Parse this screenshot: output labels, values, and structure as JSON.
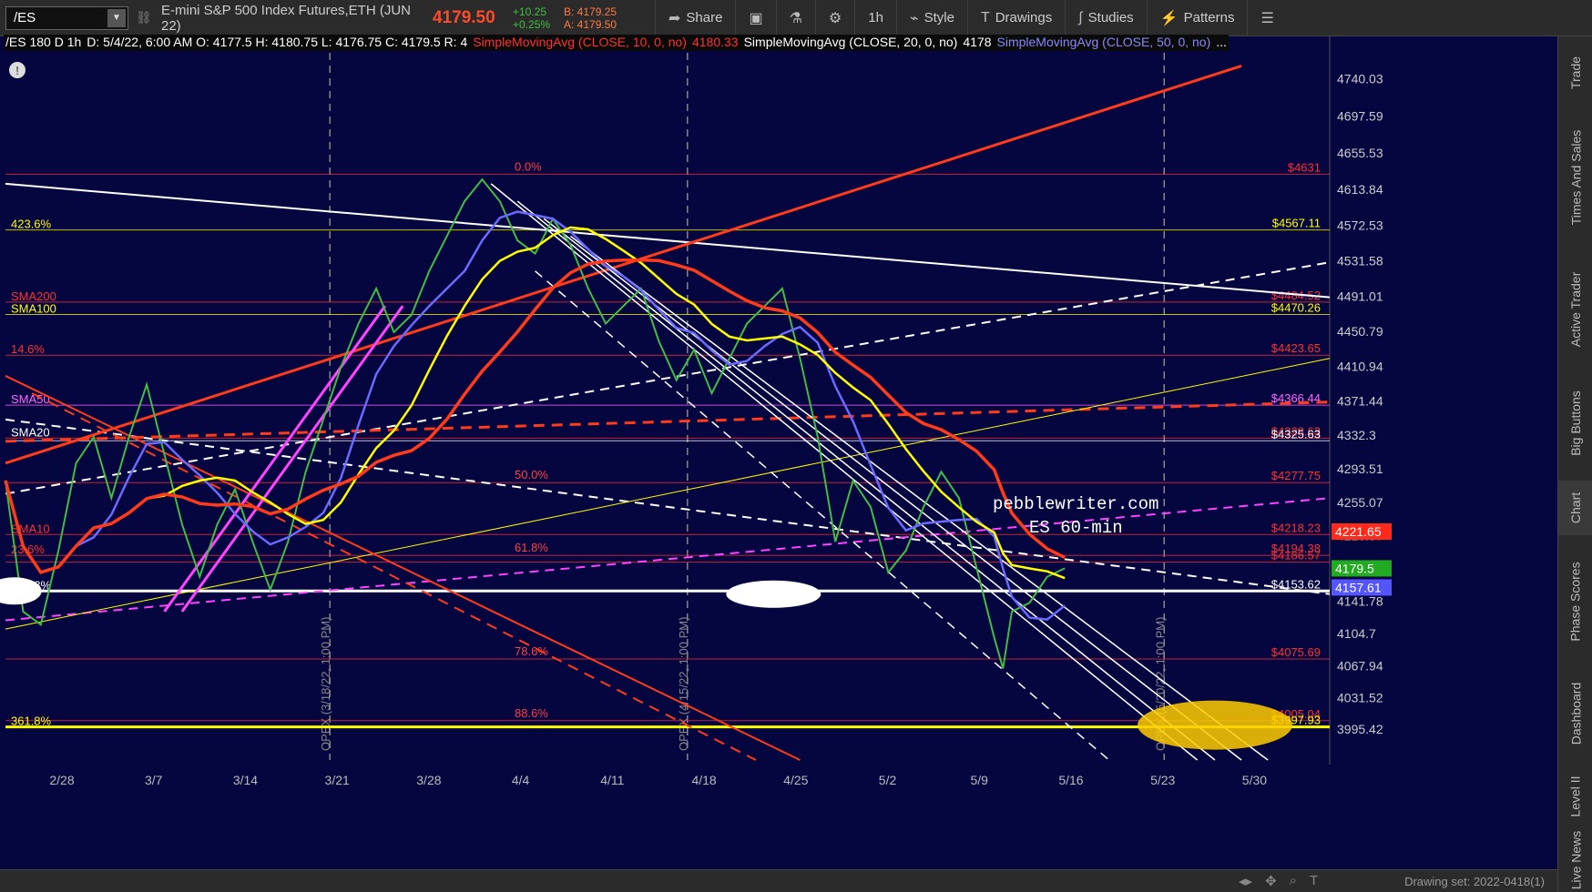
{
  "toolbar": {
    "symbol": "/ES",
    "instrument": "E-mini S&P 500 Index Futures,ETH (JUN 22)",
    "last": "4179.50",
    "change": "+10.25",
    "change_pct": "+0.25%",
    "bid": "B: 4179.25",
    "ask": "A: 4179.50",
    "buttons": [
      {
        "label": "Share",
        "icon": "share-icon"
      },
      {
        "label": "",
        "icon": "screenshot-icon"
      },
      {
        "label": "",
        "icon": "flask-icon"
      },
      {
        "label": "",
        "icon": "gear-icon"
      },
      {
        "label": "1h",
        "icon": ""
      },
      {
        "label": "Style",
        "icon": "style-icon"
      },
      {
        "label": "Drawings",
        "icon": "drawings-icon"
      },
      {
        "label": "Studies",
        "icon": "studies-icon"
      },
      {
        "label": "Patterns",
        "icon": "patterns-icon"
      },
      {
        "label": "",
        "icon": "menu-icon"
      }
    ]
  },
  "header": {
    "study_line": "/ES 180 D 1h",
    "ohlc": "D: 5/4/22, 6:00 AM  O: 4177.5  H: 4180.75  L: 4176.75  C: 4179.5  R: 4",
    "sma10": "SimpleMovingAvg (CLOSE, 10, 0, no)",
    "sma10_val": "4180.33",
    "sma20": "SimpleMovingAvg (CLOSE, 20, 0, no)",
    "sma20_val": "4178",
    "sma50": "SimpleMovingAvg (CLOSE, 50, 0, no)",
    "more": "..."
  },
  "right_tabs": [
    "Trade",
    "Times And Sales",
    "Active Trader",
    "Big Buttons",
    "Chart",
    "Phase Scores",
    "Dashboard",
    "Level II",
    "Live News"
  ],
  "bottom": {
    "drawing_set": "Drawing set: 2022-0418(1)"
  },
  "chart_data": {
    "type": "line",
    "title": "pebblewriter.com",
    "subtitle": "ES 60-min",
    "xlabel": "",
    "ylabel": "",
    "ylim": [
      3960,
      4770
    ],
    "x_ticks": [
      "2/28",
      "3/7",
      "3/14",
      "3/21",
      "3/28",
      "4/4",
      "4/11",
      "4/18",
      "4/25",
      "5/2",
      "5/9",
      "5/16",
      "5/23",
      "5/30"
    ],
    "y_ticks": [
      "4740.03",
      "4697.59",
      "4655.53",
      "4613.84",
      "4572.53",
      "4531.58",
      "4491.01",
      "4450.79",
      "4410.94",
      "4371.44",
      "4332.3",
      "4293.51",
      "4255.07",
      "4216.97",
      "4141.78",
      "4104.7",
      "4067.94",
      "4031.52",
      "3995.42"
    ],
    "price_tags": [
      {
        "label": "4221.65",
        "value": 4221.65,
        "color": "#ff2a1a"
      },
      {
        "label": "4179.5",
        "value": 4179.5,
        "color": "#22aa22"
      },
      {
        "label": "4157.61",
        "value": 4157.61,
        "color": "#5555ff"
      }
    ],
    "level_labels": [
      {
        "label": "$4631",
        "value": 4631,
        "color": "#ff3030"
      },
      {
        "label": "$4567.11",
        "value": 4567.11,
        "color": "#ffff00"
      },
      {
        "label": "$4484.52",
        "value": 4484.52,
        "color": "#ff3030"
      },
      {
        "label": "$4470.26",
        "value": 4470.26,
        "color": "#ffff00"
      },
      {
        "label": "$4423.65",
        "value": 4423.65,
        "color": "#ff3030"
      },
      {
        "label": "$4366.44",
        "value": 4366.44,
        "color": "#ff66ff"
      },
      {
        "label": "$4328.63",
        "value": 4328.63,
        "color": "#ff3030"
      },
      {
        "label": "$4325.63",
        "value": 4325.63,
        "color": "#ffffff"
      },
      {
        "label": "$4277.75",
        "value": 4277.75,
        "color": "#ff3030"
      },
      {
        "label": "$4218.23",
        "value": 4218.23,
        "color": "#ff3030"
      },
      {
        "label": "$4194.38",
        "value": 4194.38,
        "color": "#ff3030"
      },
      {
        "label": "$4186.57",
        "value": 4186.57,
        "color": "#ff3030"
      },
      {
        "label": "$4153.62",
        "value": 4153.62,
        "color": "#ffffff"
      },
      {
        "label": "$4075.69",
        "value": 4075.69,
        "color": "#ff3030"
      },
      {
        "label": "$4005.04",
        "value": 4005.04,
        "color": "#ff3030"
      },
      {
        "label": "$3997.93",
        "value": 3997.93,
        "color": "#ffff00"
      }
    ],
    "fib_labels": [
      {
        "label": "0.0%",
        "value": 4631
      },
      {
        "label": "50.0%",
        "value": 4277.75
      },
      {
        "label": "61.8%",
        "value": 4194.38
      },
      {
        "label": "78.6%",
        "value": 4075.69
      },
      {
        "label": "88.6%",
        "value": 4005.04
      }
    ],
    "left_labels": [
      {
        "label": "423.6%",
        "value": 4567.11,
        "color": "#ffff00"
      },
      {
        "label": "SMA200",
        "value": 4484.52,
        "color": "#ff3030"
      },
      {
        "label": "SMA100",
        "value": 4470.26,
        "color": "#ffff00"
      },
      {
        "label": "14.6%",
        "value": 4423.65,
        "color": "#ff3030"
      },
      {
        "label": "SMA50",
        "value": 4366.44,
        "color": "#ff66ff"
      },
      {
        "label": "SMA20",
        "value": 4328.63,
        "color": "#ffffff"
      },
      {
        "label": "SMA10",
        "value": 4218.23,
        "color": "#ff3030"
      },
      {
        "label": "23.6%",
        "value": 4194.38,
        "color": "#ff3030"
      },
      {
        "label": "161.8%",
        "value": 4153.62,
        "color": "#ffffff"
      },
      {
        "label": "361.8%",
        "value": 3997.93,
        "color": "#ffff00"
      }
    ],
    "opex_labels": [
      "OPEX (3/18/22, 1:00 PM)",
      "OPEX (4/15/22, 1:00 PM)",
      "OPEX (5/20/22, 1:00 PM)"
    ],
    "price_path": [
      [
        0,
        4280
      ],
      [
        2,
        4130
      ],
      [
        4,
        4115
      ],
      [
        6,
        4200
      ],
      [
        8,
        4300
      ],
      [
        10,
        4330
      ],
      [
        12,
        4260
      ],
      [
        14,
        4330
      ],
      [
        16,
        4390
      ],
      [
        18,
        4310
      ],
      [
        20,
        4230
      ],
      [
        22,
        4170
      ],
      [
        24,
        4230
      ],
      [
        26,
        4270
      ],
      [
        28,
        4210
      ],
      [
        30,
        4155
      ],
      [
        32,
        4210
      ],
      [
        34,
        4290
      ],
      [
        36,
        4350
      ],
      [
        38,
        4410
      ],
      [
        40,
        4460
      ],
      [
        42,
        4500
      ],
      [
        44,
        4450
      ],
      [
        46,
        4470
      ],
      [
        48,
        4520
      ],
      [
        50,
        4560
      ],
      [
        52,
        4600
      ],
      [
        54,
        4625
      ],
      [
        56,
        4600
      ],
      [
        58,
        4555
      ],
      [
        60,
        4540
      ],
      [
        62,
        4580
      ],
      [
        64,
        4550
      ],
      [
        66,
        4500
      ],
      [
        68,
        4460
      ],
      [
        70,
        4480
      ],
      [
        72,
        4500
      ],
      [
        74,
        4440
      ],
      [
        76,
        4395
      ],
      [
        78,
        4430
      ],
      [
        80,
        4380
      ],
      [
        82,
        4420
      ],
      [
        84,
        4460
      ],
      [
        86,
        4480
      ],
      [
        88,
        4500
      ],
      [
        90,
        4420
      ],
      [
        92,
        4330
      ],
      [
        94,
        4210
      ],
      [
        96,
        4280
      ],
      [
        98,
        4250
      ],
      [
        100,
        4175
      ],
      [
        102,
        4200
      ],
      [
        104,
        4250
      ],
      [
        106,
        4290
      ],
      [
        108,
        4260
      ],
      [
        110,
        4180
      ],
      [
        112,
        4100
      ],
      [
        113,
        4065
      ],
      [
        114,
        4130
      ],
      [
        116,
        4140
      ],
      [
        118,
        4170
      ],
      [
        120,
        4179.5
      ]
    ],
    "x_domain": [
      0,
      150
    ],
    "sma_series": [
      {
        "name": "SMA10",
        "color": "#6a6aff",
        "offset": 0
      },
      {
        "name": "SMA20",
        "color": "#ffff00",
        "offset": 1
      },
      {
        "name": "SMA50",
        "color": "#ff3b1a",
        "offset": 2
      }
    ],
    "target_zone": {
      "x": 137,
      "value": 4000
    }
  }
}
